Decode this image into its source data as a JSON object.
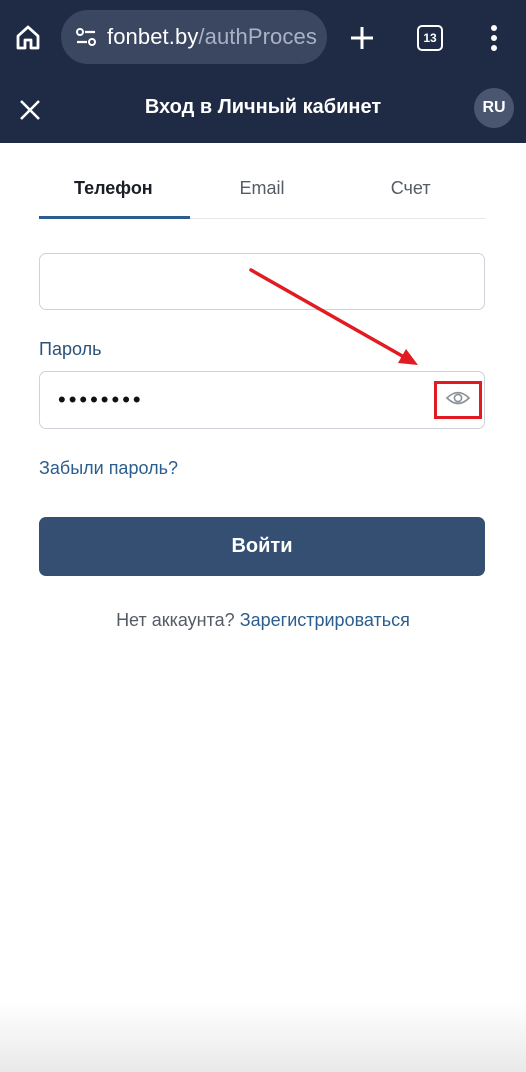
{
  "browser": {
    "url_host": "fonbet.by",
    "url_path": "/authProces",
    "tab_count": "13",
    "icons": [
      "home-icon",
      "site-settings-icon",
      "plus-icon",
      "tabs-icon",
      "more-vert-icon"
    ]
  },
  "header": {
    "title": "Вход в Личный кабинет",
    "language": "RU"
  },
  "tabs": [
    {
      "label": "Телефон",
      "active": true
    },
    {
      "label": "Email",
      "active": false
    },
    {
      "label": "Счет",
      "active": false
    }
  ],
  "form": {
    "phone_value": "",
    "password_label": "Пароль",
    "password_masked": "••••••••",
    "forgot_label": "Забыли пароль?",
    "submit_label": "Войти",
    "no_account_text": "Нет аккаунта?",
    "register_label": "Зарегистрироваться"
  },
  "colors": {
    "chrome_bg": "#1f2a44",
    "accent": "#2b5d8e",
    "button_bg": "#344f72",
    "annotation": "#e21b22"
  }
}
